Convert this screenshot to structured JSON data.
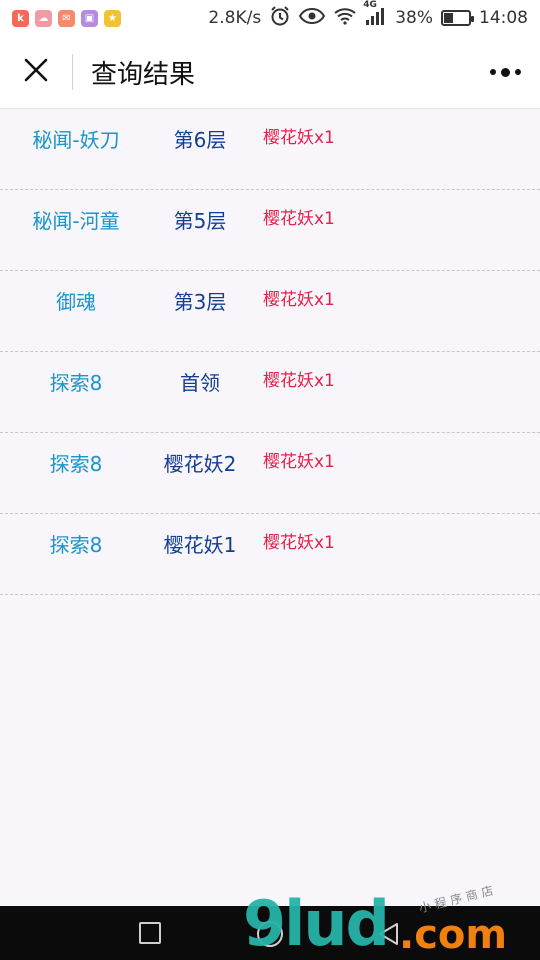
{
  "status_bar": {
    "app_icons": [
      {
        "name": "k-app-icon",
        "glyph": "k",
        "color": "#f36b57"
      },
      {
        "name": "app2-icon",
        "glyph": "☁",
        "color": "#f29aa4"
      },
      {
        "name": "mail-app-icon",
        "glyph": "✉",
        "color": "#f5896a"
      },
      {
        "name": "gallery-app-icon",
        "glyph": "▣",
        "color": "#b58ae0"
      },
      {
        "name": "star-app-icon",
        "glyph": "★",
        "color": "#f0c32f"
      }
    ],
    "speed": "2.8K/s",
    "network_label": "4G",
    "battery": "38%",
    "battery_level": 0.38,
    "time": "14:08"
  },
  "nav": {
    "title": "查询结果"
  },
  "results": [
    {
      "location": "秘闻-妖刀",
      "stage": "第6层",
      "reward": "樱花妖x1"
    },
    {
      "location": "秘闻-河童",
      "stage": "第5层",
      "reward": "樱花妖x1"
    },
    {
      "location": "御魂",
      "stage": "第3层",
      "reward": "樱花妖x1"
    },
    {
      "location": "探索8",
      "stage": "首领",
      "reward": "樱花妖x1"
    },
    {
      "location": "探索8",
      "stage": "樱花妖2",
      "reward": "樱花妖x1"
    },
    {
      "location": "探索8",
      "stage": "樱花妖1",
      "reward": "樱花妖x1"
    }
  ],
  "watermark": {
    "main": "9lud",
    "suffix": ".com",
    "small": "小程序商店"
  }
}
